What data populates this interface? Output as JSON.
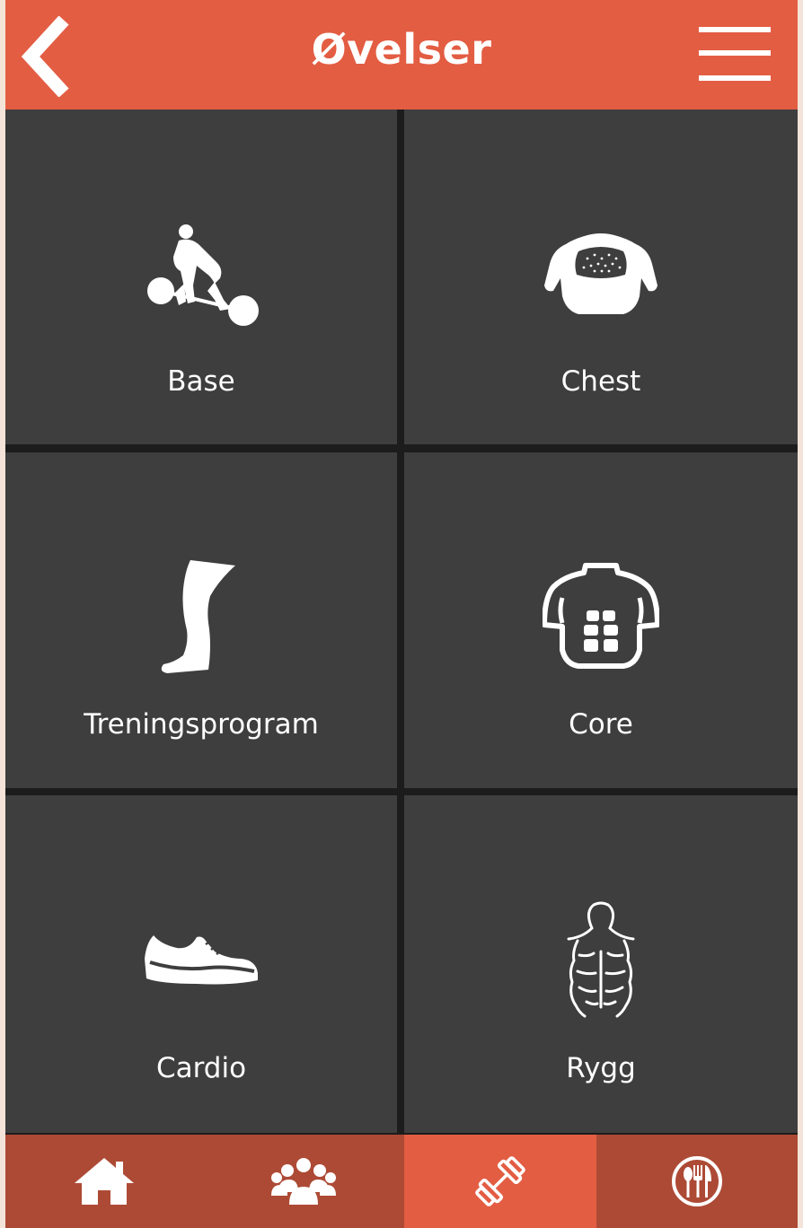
{
  "header": {
    "title": "Øvelser",
    "back_icon": "chevron-left-icon",
    "menu_icon": "hamburger-menu-icon"
  },
  "tiles": [
    {
      "label": "Base",
      "icon": "deadlift-icon"
    },
    {
      "label": "Chest",
      "icon": "chest-icon"
    },
    {
      "label": "Treningsprogram",
      "icon": "leg-icon"
    },
    {
      "label": "Core",
      "icon": "abs-icon"
    },
    {
      "label": "Cardio",
      "icon": "sneaker-icon"
    },
    {
      "label": "Rygg",
      "icon": "back-muscles-icon"
    }
  ],
  "tabbar": {
    "items": [
      {
        "icon": "home-icon",
        "active": false
      },
      {
        "icon": "group-icon",
        "active": false
      },
      {
        "icon": "dumbbell-icon",
        "active": true
      },
      {
        "icon": "restaurant-icon",
        "active": false
      }
    ]
  },
  "colors": {
    "accent": "#e35d43",
    "tabbar": "#ad4a35",
    "tile": "#3e3e3e",
    "gap": "#1c1c1c"
  }
}
